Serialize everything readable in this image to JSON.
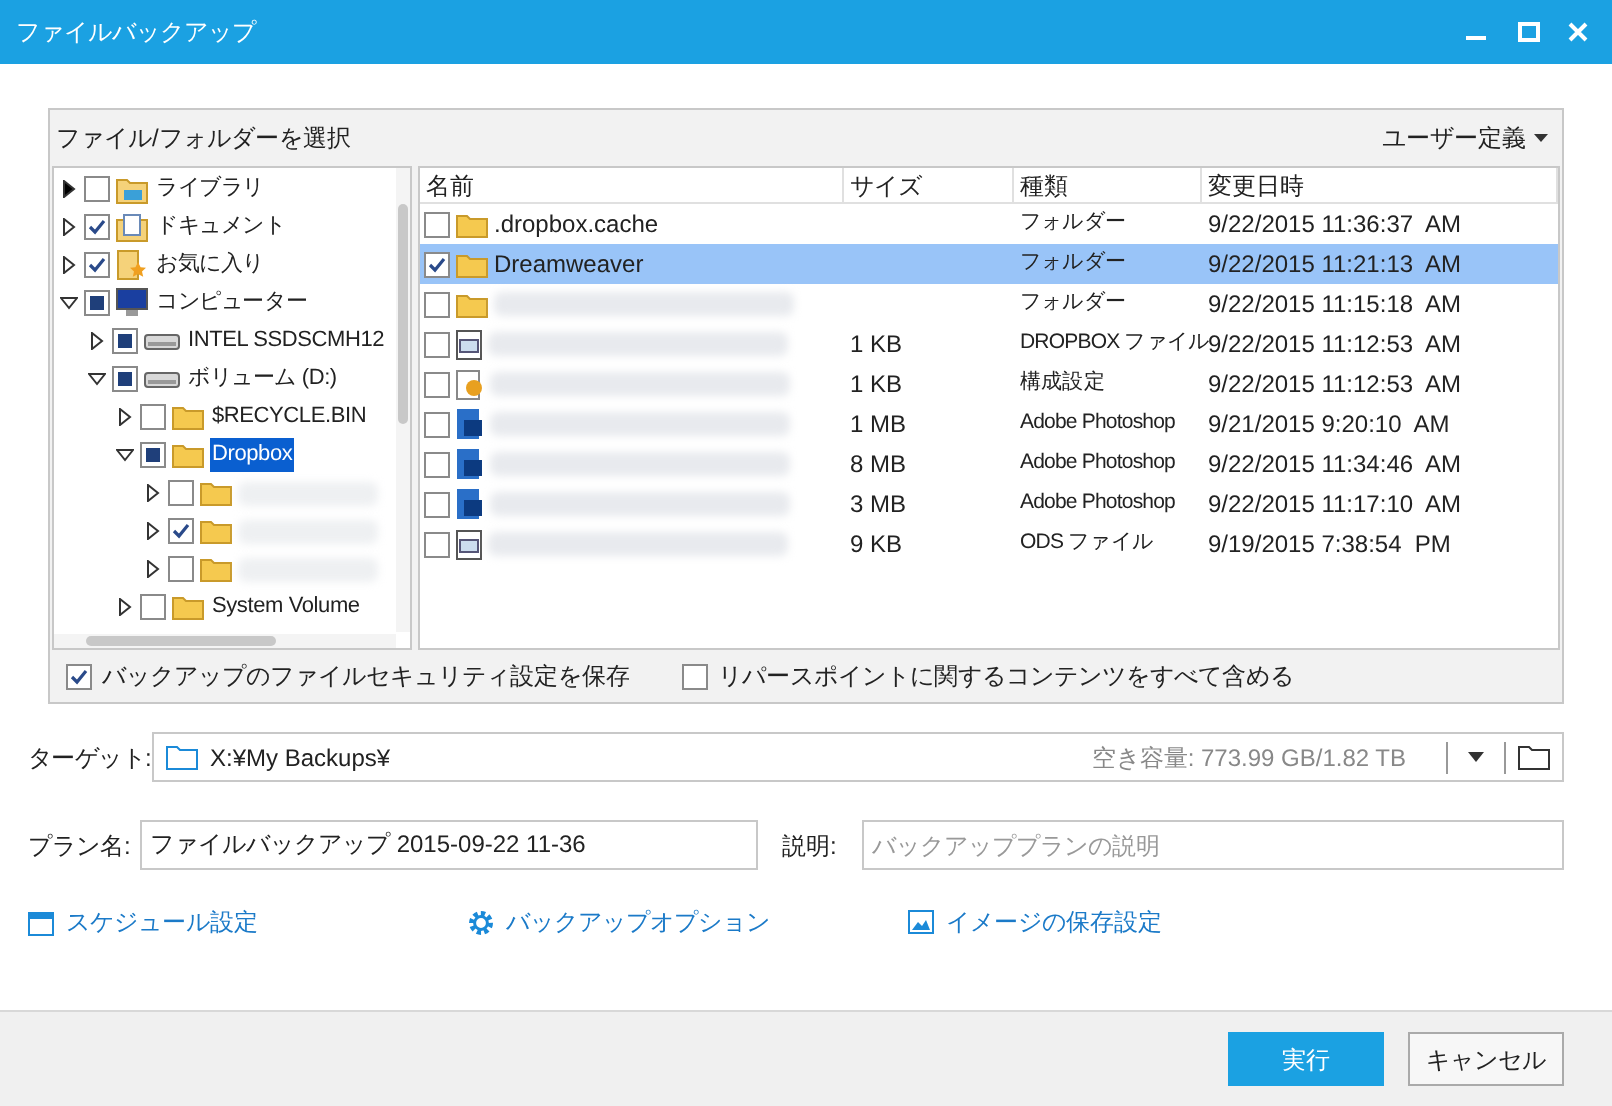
{
  "window": {
    "title": "ファイルバックアップ"
  },
  "source": {
    "title": "ファイル/フォルダーを選択",
    "view_menu": "ユーザー定義",
    "tree": [
      {
        "label": "ライブラリ",
        "kind": "library",
        "checked": false,
        "partial": false,
        "expanded": false
      },
      {
        "label": "ドキュメント",
        "kind": "documents",
        "checked": true,
        "partial": false,
        "expanded": false
      },
      {
        "label": "お気に入り",
        "kind": "favorites",
        "checked": true,
        "partial": false,
        "expanded": false
      },
      {
        "label": "コンピューター",
        "kind": "computer",
        "checked": false,
        "partial": true,
        "expanded": true,
        "children": [
          {
            "label": "INTEL SSDSCMH12",
            "kind": "drive",
            "checked": false,
            "partial": true,
            "expanded": false
          },
          {
            "label": "ボリューム (D:)",
            "kind": "drive",
            "checked": false,
            "partial": true,
            "expanded": true,
            "children": [
              {
                "label": "$RECYCLE.BIN",
                "kind": "folder",
                "checked": false,
                "partial": false,
                "expanded": false
              },
              {
                "label": "Dropbox",
                "kind": "folder",
                "checked": false,
                "partial": true,
                "expanded": true,
                "selected": true,
                "children": [
                  {
                    "kind": "folder",
                    "checked": false,
                    "partial": false,
                    "expanded": false
                  },
                  {
                    "kind": "folder",
                    "checked": true,
                    "partial": false,
                    "expanded": false
                  },
                  {
                    "kind": "folder",
                    "checked": false,
                    "partial": false,
                    "expanded": false
                  }
                ]
              },
              {
                "label": "System Volume",
                "kind": "folder",
                "checked": false,
                "partial": false,
                "expanded": false
              }
            ]
          }
        ]
      }
    ],
    "columns": [
      "名前",
      "サイズ",
      "種類",
      "変更日時"
    ],
    "files": [
      {
        "name": ".dropbox.cache",
        "kind": "folder",
        "checked": false,
        "selected": false,
        "type": "フォルダー",
        "modified": "9/22/2015 11:36:37  AM"
      },
      {
        "name": "Dreamweaver",
        "kind": "folder",
        "checked": true,
        "selected": true,
        "type": "フォルダー",
        "modified": "9/22/2015 11:21:13  AM"
      },
      {
        "kind": "folder",
        "checked": false,
        "selected": false,
        "type": "フォルダー",
        "modified": "9/22/2015 11:15:18  AM"
      },
      {
        "kind": "window",
        "checked": false,
        "selected": false,
        "size": "1 KB",
        "type": "DROPBOX ファイル",
        "modified": "9/22/2015 11:12:53  AM"
      },
      {
        "kind": "config",
        "checked": false,
        "selected": false,
        "size": "1 KB",
        "type": "構成設定",
        "modified": "9/22/2015 11:12:53  AM"
      },
      {
        "kind": "photoshop",
        "checked": false,
        "selected": false,
        "size": "1 MB",
        "type": "Adobe Photoshop",
        "modified": "9/21/2015 9:20:10  AM"
      },
      {
        "kind": "photoshop",
        "checked": false,
        "selected": false,
        "size": "8 MB",
        "type": "Adobe Photoshop",
        "modified": "9/22/2015 11:34:46  AM"
      },
      {
        "kind": "photoshop",
        "checked": false,
        "selected": false,
        "size": "3 MB",
        "type": "Adobe Photoshop",
        "modified": "9/22/2015 11:17:10  AM"
      },
      {
        "kind": "window",
        "checked": false,
        "selected": false,
        "size": "9 KB",
        "type": "ODS ファイル",
        "modified": "9/19/2015 7:38:54  PM"
      }
    ],
    "options": [
      {
        "label": "バックアップのファイルセキュリティ設定を保存",
        "checked": true
      },
      {
        "label": "リパースポイントに関するコンテンツをすべて含める",
        "checked": false
      }
    ]
  },
  "target": {
    "label": "ターゲット:",
    "path": "X:¥My Backups¥",
    "free_space": "空き容量: 773.99 GB/1.82 TB"
  },
  "plan_name": {
    "label": "プラン名:",
    "value": "ファイルバックアップ 2015-09-22 11-36"
  },
  "description": {
    "label": "説明:",
    "placeholder": "バックアッププランの説明"
  },
  "links": [
    {
      "label": "スケジュール設定",
      "kind": "calendar"
    },
    {
      "label": "バックアップオプション",
      "kind": "gear"
    },
    {
      "label": "イメージの保存設定",
      "kind": "image"
    }
  ],
  "buttons": [
    {
      "label": "実行",
      "kind": "primary"
    },
    {
      "label": "キャンセル",
      "kind": "secondary"
    }
  ]
}
